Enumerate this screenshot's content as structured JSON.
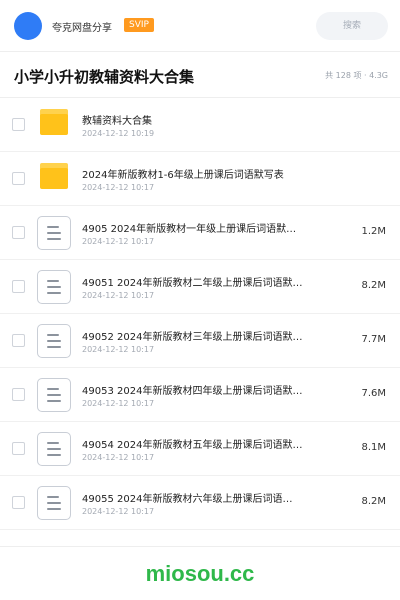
{
  "header": {
    "user_name": "夸克网盘分享",
    "vip_label": "SVIP",
    "search_placeholder": "搜索"
  },
  "share": {
    "title": "小学小升初教辅资料大合集",
    "meta": "共 128 项 · 4.3G"
  },
  "files": [
    {
      "type": "folder",
      "name": "教辅资料大合集",
      "date": "2024-12-12 10:19",
      "size": ""
    },
    {
      "type": "folder",
      "name": "2024年新版教材1-6年级上册课后词语默写表",
      "date": "2024-12-12 10:17",
      "size": ""
    },
    {
      "type": "doc",
      "name": "4905  2024年新版教材一年级上册课后词语默…",
      "date": "2024-12-12 10:17",
      "size": "1.2M"
    },
    {
      "type": "doc",
      "name": "49051 2024年新版教材二年级上册课后词语默…",
      "date": "2024-12-12 10:17",
      "size": "8.2M"
    },
    {
      "type": "doc",
      "name": "49052 2024年新版教材三年级上册课后词语默…",
      "date": "2024-12-12 10:17",
      "size": "7.7M"
    },
    {
      "type": "doc",
      "name": "49053 2024年新版教材四年级上册课后词语默…",
      "date": "2024-12-12 10:17",
      "size": "7.6M"
    },
    {
      "type": "doc",
      "name": "49054 2024年新版教材五年级上册课后词语默…",
      "date": "2024-12-12 10:17",
      "size": "8.1M"
    },
    {
      "type": "doc",
      "name": "49055  2024年新版教材六年级上册课后词语…",
      "date": "2024-12-12 10:17",
      "size": "8.2M"
    }
  ],
  "footer": {
    "watermark": "miosou.cc"
  },
  "colors": {
    "accent": "#2f7cf6",
    "vip": "#ff9a1f",
    "folder": "#ffc21a",
    "watermark": "#2fb84a"
  }
}
